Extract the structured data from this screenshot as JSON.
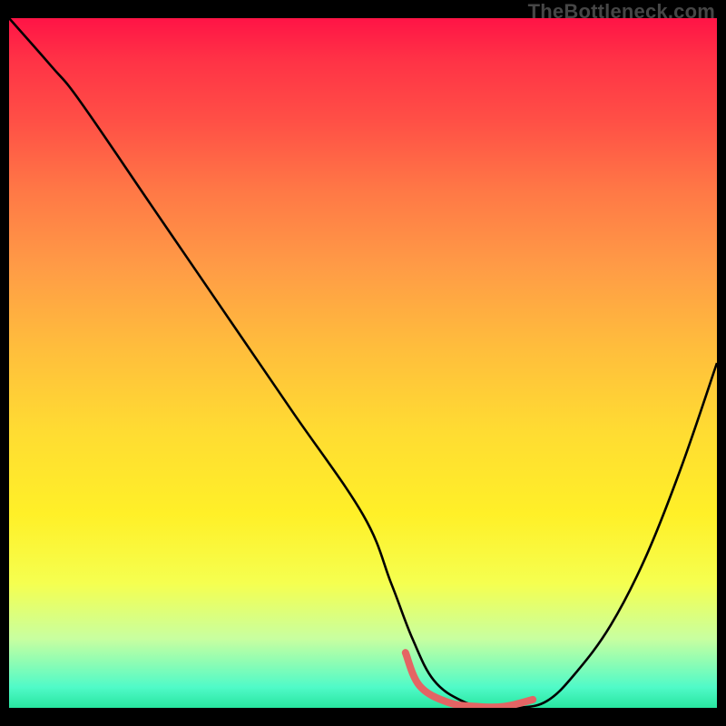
{
  "attribution": "TheBottleneck.com",
  "chart_data": {
    "type": "line",
    "title": "",
    "xlabel": "",
    "ylabel": "",
    "axes_visible": false,
    "gradient_colors": {
      "top": "#FF1446",
      "mid_upper": "#FF7846",
      "mid": "#FFDC32",
      "lower": "#C8FFA0",
      "bottom": "#28E6A0"
    },
    "xlim": [
      0,
      100
    ],
    "ylim": [
      0,
      100
    ],
    "series": [
      {
        "name": "curve",
        "color": "#000000",
        "x": [
          0,
          6,
          10,
          20,
          30,
          40,
          50,
          54,
          57,
          60,
          64,
          68,
          72,
          76,
          80,
          85,
          90,
          95,
          100
        ],
        "y": [
          100,
          93,
          88,
          73,
          58,
          43,
          28,
          18,
          10,
          4,
          1,
          0,
          0,
          1,
          5,
          12,
          22,
          35,
          50
        ]
      }
    ],
    "highlight": {
      "name": "flat-region",
      "color": "#E46464",
      "x": [
        56,
        58,
        62,
        66,
        70,
        74
      ],
      "y": [
        8,
        3.2,
        0.8,
        0.2,
        0.2,
        1.2
      ]
    }
  }
}
